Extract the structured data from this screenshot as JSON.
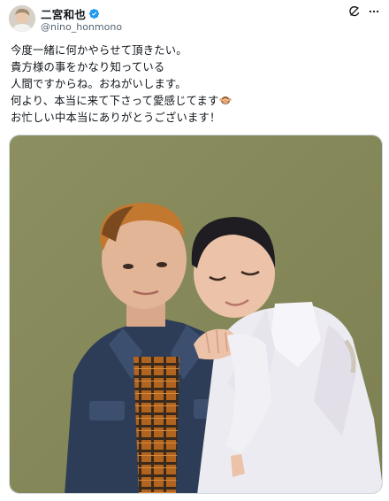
{
  "tweet": {
    "author": {
      "display_name": "二宮和也",
      "handle": "@nino_honmono",
      "verified": true,
      "avatar_icon": "profile-photo"
    },
    "actions": {
      "grok_icon": "grok-icon",
      "more_icon": "more-options-icon"
    },
    "text_lines": [
      "今度一緒に何かやらせて頂きたい。",
      "貴方様の事をかなり知っている",
      "人間ですからね。おねがいします。",
      "何より、本当に来て下さって愛感じてます",
      "お忙しい中本当にありがとうございます！"
    ],
    "media": {
      "type": "photo",
      "subject": "two-people-posing-photo"
    }
  },
  "colors": {
    "verified_badge": "#1d9bf0",
    "text": "#0f1419",
    "secondary_text": "#536471",
    "photo_wall": "#8a8c5e"
  }
}
